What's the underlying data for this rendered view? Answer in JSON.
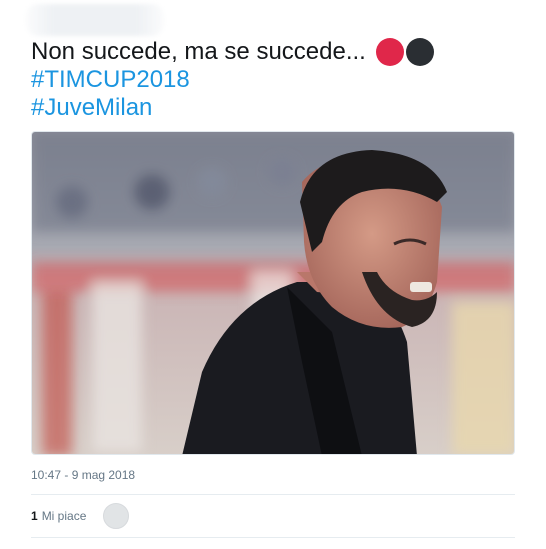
{
  "tweet": {
    "line1": "Non succede, ma se succede...",
    "emoji_colors": [
      "#e0274a",
      "#2a2e33"
    ],
    "hashtag1": "#TIMCUP2018",
    "hashtag2": "#JuveMilan"
  },
  "media": {
    "description_icon": "photo-icon"
  },
  "meta": {
    "timestamp": "10:47 - 9 mag 2018"
  },
  "likes": {
    "count": "1",
    "label": "Mi piace"
  }
}
